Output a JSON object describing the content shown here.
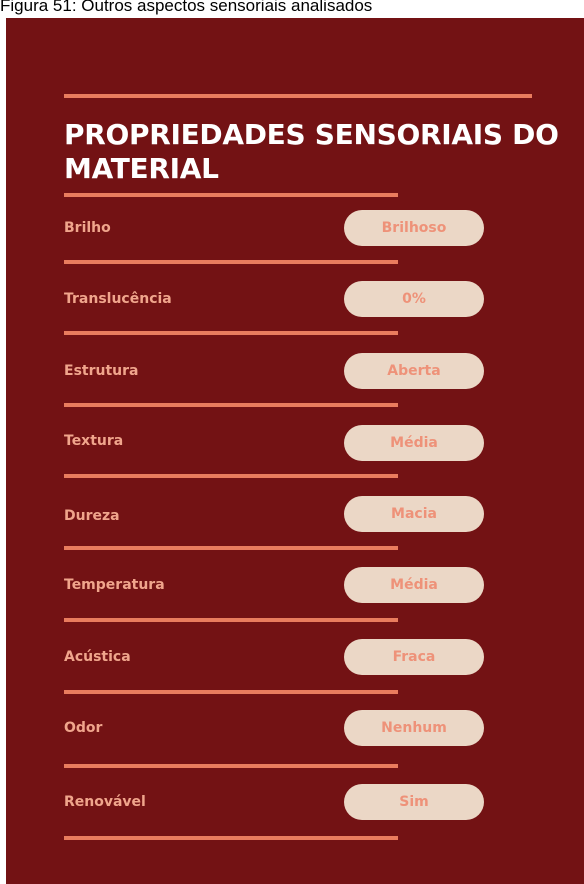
{
  "caption": "Figura 51: Outros aspectos sensoriais analisados",
  "card": {
    "title": "PROPRIEDADES SENSORIAIS DO MATERIAL",
    "colors": {
      "background": "#731214",
      "rule": "#e97c5e",
      "label": "#f0a58c",
      "pill_bg": "#ebd7c6",
      "pill_text": "#ee9279"
    },
    "properties": [
      {
        "label": "Brilho",
        "value": "Brilhoso"
      },
      {
        "label": "Translucência",
        "value": "0%"
      },
      {
        "label": "Estrutura",
        "value": "Aberta"
      },
      {
        "label": "Textura",
        "value": "Média"
      },
      {
        "label": "Dureza",
        "value": "Macia"
      },
      {
        "label": "Temperatura",
        "value": "Média"
      },
      {
        "label": "Acústica",
        "value": "Fraca"
      },
      {
        "label": "Odor",
        "value": "Nenhum"
      },
      {
        "label": "Renovável",
        "value": "Sim"
      }
    ]
  }
}
